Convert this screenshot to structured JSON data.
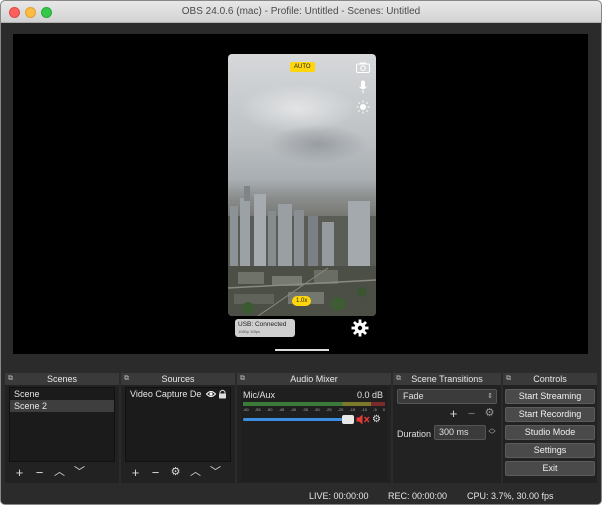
{
  "window": {
    "title": "OBS 24.0.6 (mac) - Profile: Untitled - Scenes: Untitled"
  },
  "preview": {
    "auto_badge": "AUTO",
    "zoom_badge": "1.0x",
    "usb_status": "USB: Connected",
    "usb_sub": "1080p 30fps",
    "icons": [
      "camera-icon",
      "microphone-icon",
      "brightness-icon",
      "gear-icon"
    ]
  },
  "scenes": {
    "header": "Scenes",
    "items": [
      "Scene",
      "Scene 2"
    ],
    "selected_index": 1
  },
  "sources": {
    "header": "Sources",
    "items": [
      {
        "label": "Video Capture De",
        "visible": true,
        "locked": true
      }
    ]
  },
  "audio_mixer": {
    "header": "Audio Mixer",
    "channels": [
      {
        "name": "Mic/Aux",
        "level": "0.0 dB",
        "muted": true,
        "volume_fraction": 0.92
      }
    ],
    "scale": [
      "-60",
      "-55",
      "-50",
      "-45",
      "-40",
      "-35",
      "-30",
      "-25",
      "-20",
      "-15",
      "-10",
      "-5",
      "0"
    ]
  },
  "transitions": {
    "header": "Scene Transitions",
    "selected": "Fade",
    "duration_label": "Duration",
    "duration_value": "300 ms"
  },
  "controls": {
    "header": "Controls",
    "buttons": [
      "Start Streaming",
      "Start Recording",
      "Studio Mode",
      "Settings",
      "Exit"
    ]
  },
  "status": {
    "live": "LIVE: 00:00:00",
    "rec": "REC: 00:00:00",
    "cpu": "CPU: 3.7%, 30.00 fps"
  },
  "colors": {
    "accent_yellow": "#ffd60a",
    "meter_green": "#4caf50",
    "meter_yellow": "#c8c800",
    "mute_red": "#e53935",
    "slider_blue": "#3d8ee0"
  }
}
